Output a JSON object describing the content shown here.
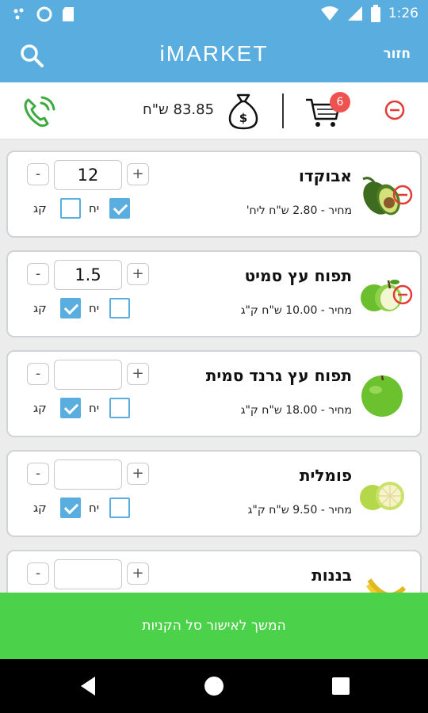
{
  "status_bar": {
    "time": "1:26"
  },
  "app_bar": {
    "title": "iMARKET",
    "back_label": "חזור"
  },
  "cart": {
    "total": "83.85 ש\"ח",
    "item_count": "6"
  },
  "products": [
    {
      "name": "אבוקדו",
      "price": "מחיר - 2.80 ש\"ח ליח'",
      "qty": "12",
      "unit_yah": "יח",
      "unit_kg": "קג",
      "yah_checked": true,
      "kg_checked": false,
      "removable": true
    },
    {
      "name": "תפוח עץ סמיט",
      "price": "מחיר - 10.00 ש\"ח ק\"ג",
      "qty": "1.5",
      "unit_yah": "יח",
      "unit_kg": "קג",
      "yah_checked": false,
      "kg_checked": true,
      "removable": true
    },
    {
      "name": "תפוח עץ גרנד סמית",
      "price": "מחיר - 18.00 ש\"ח ק\"ג",
      "qty": "",
      "unit_yah": "יח",
      "unit_kg": "קג",
      "yah_checked": false,
      "kg_checked": true,
      "removable": false
    },
    {
      "name": "פומלית",
      "price": "מחיר - 9.50 ש\"ח ק\"ג",
      "qty": "",
      "unit_yah": "יח",
      "unit_kg": "קג",
      "yah_checked": false,
      "kg_checked": true,
      "removable": false
    },
    {
      "name": "בננות",
      "qty": ""
    }
  ],
  "continue_label": "המשך לאישור סל הקניות",
  "colors": {
    "primary": "#5aaedf",
    "accent": "#4cd14a",
    "danger": "#ef5350"
  }
}
